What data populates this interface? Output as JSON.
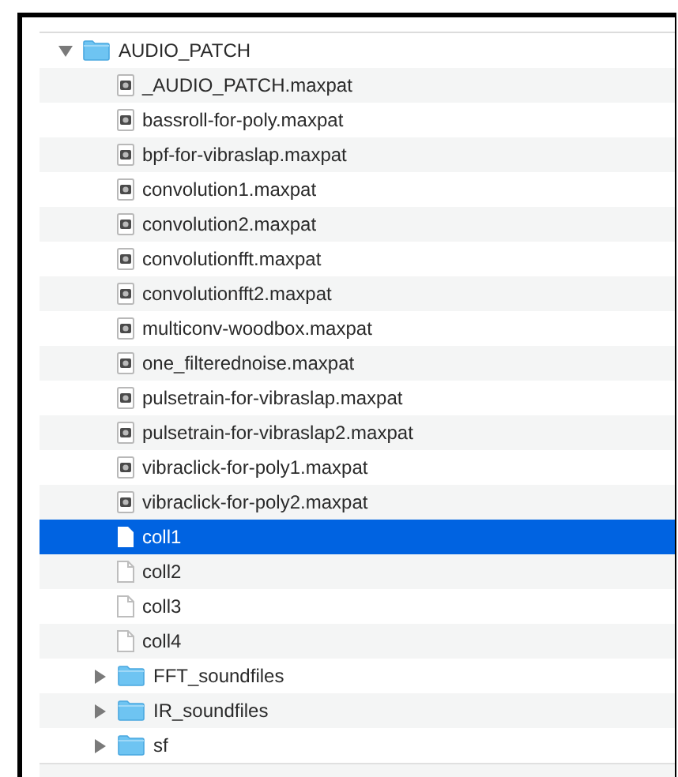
{
  "tree": [
    {
      "name": "AUDIO_PATCH",
      "kind": "folder",
      "expanded": true,
      "selected": false,
      "children": [
        {
          "name": "_AUDIO_PATCH.maxpat",
          "kind": "patch",
          "selected": false
        },
        {
          "name": "bassroll-for-poly.maxpat",
          "kind": "patch",
          "selected": false
        },
        {
          "name": "bpf-for-vibraslap.maxpat",
          "kind": "patch",
          "selected": false
        },
        {
          "name": "convolution1.maxpat",
          "kind": "patch",
          "selected": false
        },
        {
          "name": "convolution2.maxpat",
          "kind": "patch",
          "selected": false
        },
        {
          "name": "convolutionfft.maxpat",
          "kind": "patch",
          "selected": false
        },
        {
          "name": "convolutionfft2.maxpat",
          "kind": "patch",
          "selected": false
        },
        {
          "name": "multiconv-woodbox.maxpat",
          "kind": "patch",
          "selected": false
        },
        {
          "name": "one_filterednoise.maxpat",
          "kind": "patch",
          "selected": false
        },
        {
          "name": "pulsetrain-for-vibraslap.maxpat",
          "kind": "patch",
          "selected": false
        },
        {
          "name": "pulsetrain-for-vibraslap2.maxpat",
          "kind": "patch",
          "selected": false
        },
        {
          "name": "vibraclick-for-poly1.maxpat",
          "kind": "patch",
          "selected": false
        },
        {
          "name": "vibraclick-for-poly2.maxpat",
          "kind": "patch",
          "selected": false
        },
        {
          "name": "coll1",
          "kind": "file",
          "selected": true
        },
        {
          "name": "coll2",
          "kind": "file",
          "selected": false
        },
        {
          "name": "coll3",
          "kind": "file",
          "selected": false
        },
        {
          "name": "coll4",
          "kind": "file",
          "selected": false
        },
        {
          "name": "FFT_soundfiles",
          "kind": "folder",
          "expanded": false,
          "selected": false
        },
        {
          "name": "IR_soundfiles",
          "kind": "folder",
          "expanded": false,
          "selected": false
        },
        {
          "name": "sf",
          "kind": "folder",
          "expanded": false,
          "selected": false
        }
      ]
    }
  ]
}
